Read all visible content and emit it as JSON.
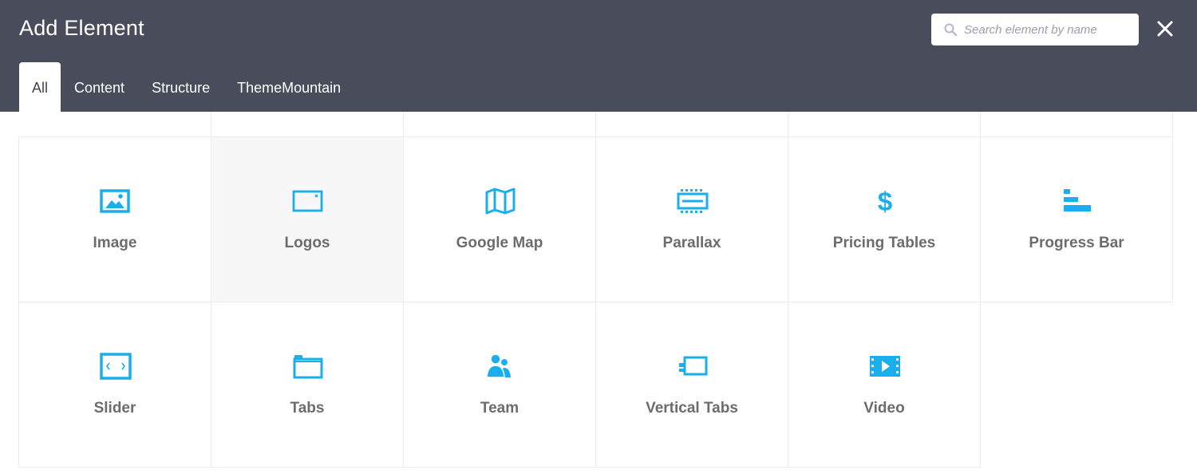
{
  "header": {
    "title": "Add Element",
    "search_placeholder": "Search element by name",
    "close_icon": "close-icon"
  },
  "tabs": [
    {
      "label": "All",
      "active": true
    },
    {
      "label": "Content",
      "active": false
    },
    {
      "label": "Structure",
      "active": false
    },
    {
      "label": "ThemeMountain",
      "active": false
    }
  ],
  "elements": [
    {
      "label": "Image",
      "icon": "image-icon"
    },
    {
      "label": "Logos",
      "icon": "logos-icon"
    },
    {
      "label": "Google Map",
      "icon": "map-icon"
    },
    {
      "label": "Parallax",
      "icon": "parallax-icon"
    },
    {
      "label": "Pricing Tables",
      "icon": "dollar-icon"
    },
    {
      "label": "Progress Bar",
      "icon": "progress-bar-icon"
    },
    {
      "label": "Slider",
      "icon": "slider-icon"
    },
    {
      "label": "Tabs",
      "icon": "tabs-icon"
    },
    {
      "label": "Team",
      "icon": "team-icon"
    },
    {
      "label": "Vertical Tabs",
      "icon": "vertical-tabs-icon"
    },
    {
      "label": "Video",
      "icon": "video-icon"
    }
  ],
  "colors": {
    "header_bg": "#484c5b",
    "accent": "#1aaeec",
    "label": "#6c6c6c",
    "border": "#ececec"
  }
}
